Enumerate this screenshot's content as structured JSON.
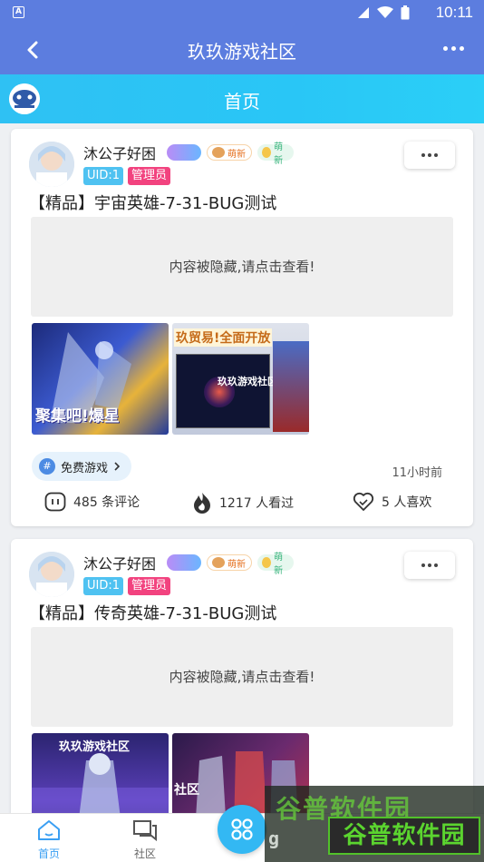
{
  "status_bar": {
    "time": "10:11",
    "app_badge": "A"
  },
  "app_bar": {
    "title": "玖玖游戏社区"
  },
  "tab_header": {
    "title": "首页"
  },
  "posts": [
    {
      "username": "沐公子好困",
      "badges": {
        "new": "萌新",
        "meng": "萌新"
      },
      "uid": "UID:1",
      "role": "管理员",
      "title": "【精品】宇宙英雄-7-31-BUG测试",
      "hidden_text": "内容被隐藏,请点击查看!",
      "thumb_texts": [
        "聚集吧!爆星",
        "玖贸易!全面开放",
        "玖玖游戏社区"
      ],
      "topic": "免费游戏",
      "topic_icon": "#",
      "time_ago": "11小时前",
      "comments": "485 条评论",
      "views": "1217 人看过",
      "likes": "5 人喜欢"
    },
    {
      "username": "沐公子好困",
      "badges": {
        "new": "萌新",
        "meng": "萌新"
      },
      "uid": "UID:1",
      "role": "管理员",
      "title": "【精品】传奇英雄-7-31-BUG测试",
      "hidden_text": "内容被隐藏,请点击查看!",
      "thumb_texts": [
        "玖玖游戏社区",
        "社区"
      ]
    }
  ],
  "bottom_nav": {
    "home": "首页",
    "community": "社区"
  },
  "watermark": {
    "top": "谷普软件园",
    "bottom": "谷普软件园",
    "url": "g"
  },
  "colors": {
    "primary": "#5c7ddf",
    "header": "#2fc1f3",
    "accent": "#3a9ff3",
    "admin": "#f2437f",
    "uid": "#4fc2f1"
  }
}
